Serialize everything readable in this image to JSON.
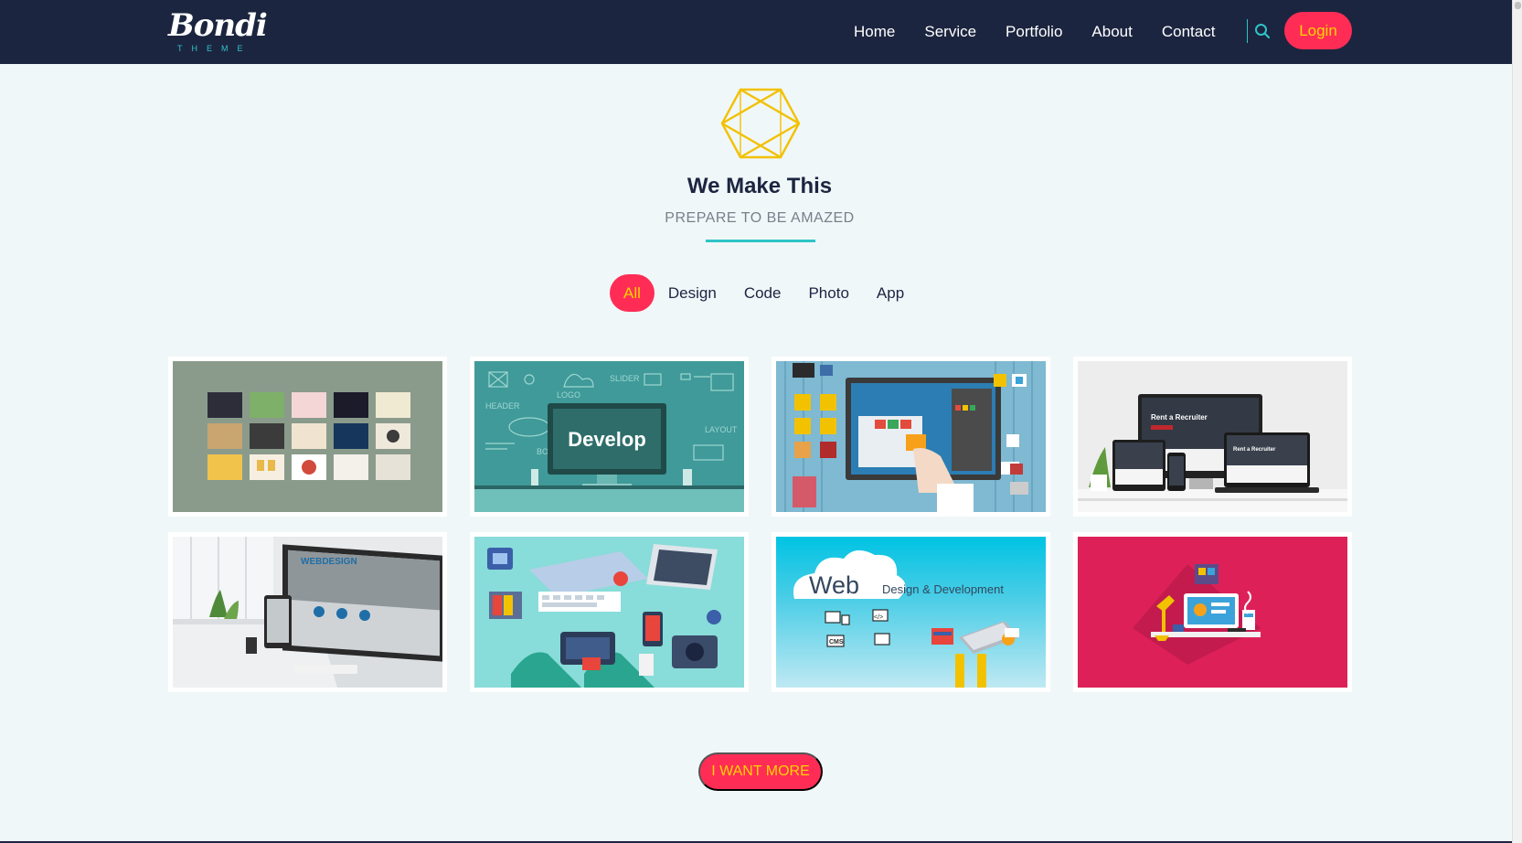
{
  "brand": {
    "name": "Bondi",
    "tagline": "THEME"
  },
  "nav": {
    "links": [
      "Home",
      "Service",
      "Portfolio",
      "About",
      "Contact"
    ],
    "login_label": "Login"
  },
  "section": {
    "title": "We Make This",
    "subtitle": "PREPARE TO BE AMAZED"
  },
  "filters": {
    "items": [
      "All",
      "Design",
      "Code",
      "Photo",
      "App"
    ],
    "active": "All"
  },
  "portfolio": {
    "tiles": [
      {
        "alt": "design-cards",
        "text": ""
      },
      {
        "alt": "develop",
        "text": "Develop"
      },
      {
        "alt": "web-design-screen",
        "text": ""
      },
      {
        "alt": "responsive-devices",
        "text": "Rent a Recruiter"
      },
      {
        "alt": "webdesign-desk",
        "text": "WEBDESIGN"
      },
      {
        "alt": "workspace-flatlay",
        "text": ""
      },
      {
        "alt": "web-design-development",
        "text": "Web",
        "text2": "Design & Development"
      },
      {
        "alt": "isometric-desk",
        "text": ""
      }
    ]
  },
  "cta": {
    "label": "I WANT MORE"
  },
  "colors": {
    "navbar": "#1c2540",
    "accent": "#ff2d55",
    "accent_text": "#ffd400",
    "teal": "#2ec4c6",
    "background": "#f0f7f9"
  }
}
